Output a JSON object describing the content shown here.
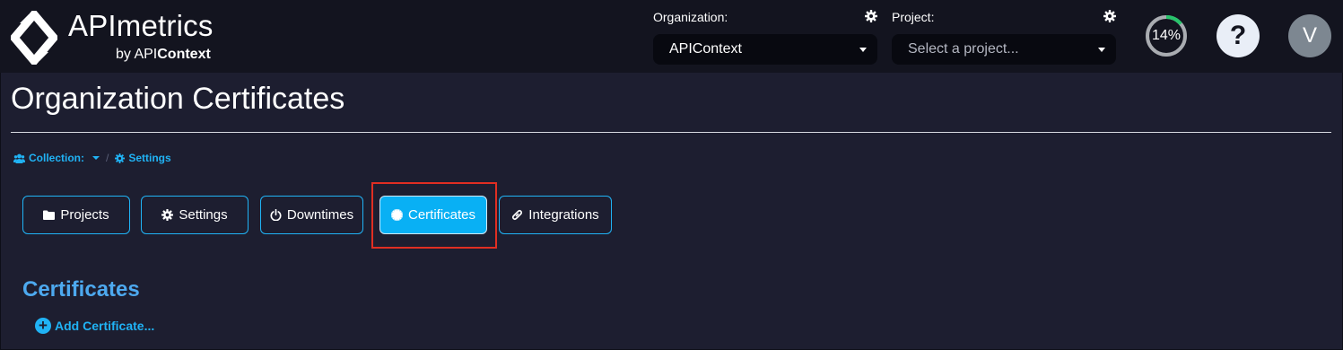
{
  "header": {
    "brand_name": "APImetrics",
    "brand_by": "by API",
    "brand_by_bold": "Context",
    "organization_label": "Organization:",
    "organization_value": "APIContext",
    "project_label": "Project:",
    "project_placeholder": "Select a project...",
    "progress_text": "14%",
    "progress_value": 0.14,
    "help_symbol": "?",
    "avatar_initial": "V"
  },
  "page": {
    "title": "Organization Certificates"
  },
  "breadcrumb": {
    "collection_label": "Collection:",
    "separator": "/",
    "settings_label": "Settings"
  },
  "tabs": [
    {
      "label": "Projects",
      "icon": "folder-icon"
    },
    {
      "label": "Settings",
      "icon": "gear-icon"
    },
    {
      "label": "Downtimes",
      "icon": "power-icon"
    },
    {
      "label": "Certificates",
      "icon": "certificate-icon",
      "active": true
    },
    {
      "label": "Integrations",
      "icon": "link-icon"
    }
  ],
  "section": {
    "title": "Certificates",
    "add_label": "Add Certificate...",
    "add_symbol": "+"
  },
  "colors": {
    "background": "#1d1e30",
    "topbar": "#13141f",
    "accent": "#20b3f5",
    "active_tab": "#09b0f4",
    "section_title": "#4da9ef",
    "highlight": "#e02e22"
  }
}
